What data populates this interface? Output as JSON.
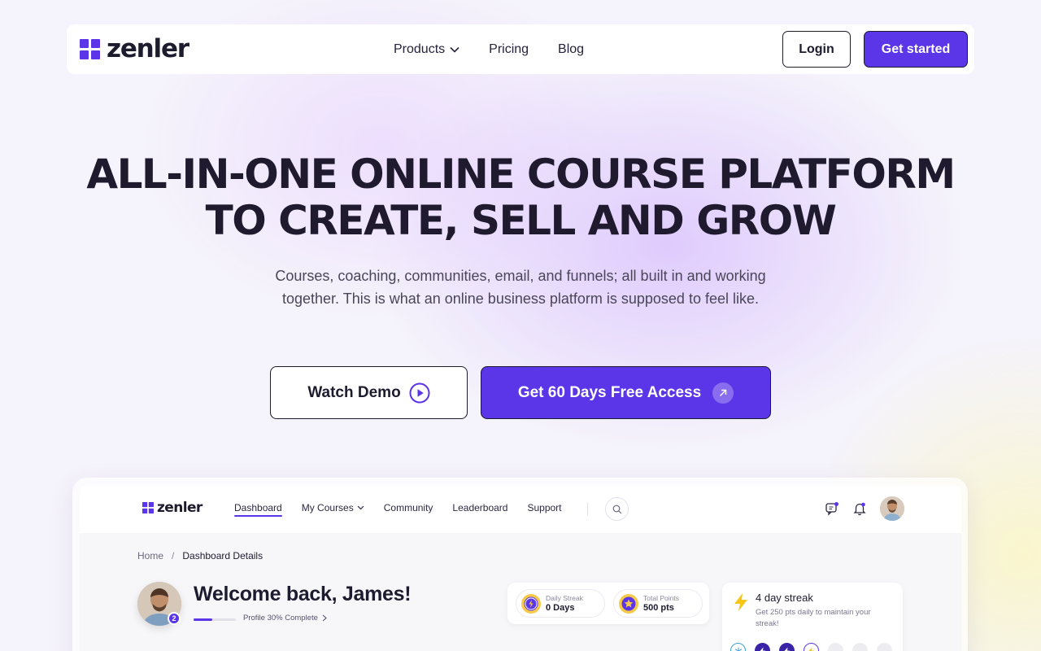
{
  "nav": {
    "brand": "zenler",
    "links": [
      {
        "label": "Products",
        "has_dropdown": true
      },
      {
        "label": "Pricing"
      },
      {
        "label": "Blog"
      }
    ],
    "login_label": "Login",
    "get_started_label": "Get started"
  },
  "hero": {
    "title_line1": "ALL-IN-ONE ONLINE COURSE PLATFORM",
    "title_line2": "TO CREATE, SELL AND GROW",
    "subtitle": "Courses, coaching, communities, email, and funnels; all built in and working together. This is what an online business platform is supposed to feel like.",
    "watch_demo_label": "Watch Demo",
    "free_access_label": "Get 60 Days Free Access"
  },
  "app": {
    "brand": "zenler",
    "links": [
      {
        "label": "Dashboard",
        "active": true
      },
      {
        "label": "My Courses",
        "has_dropdown": true
      },
      {
        "label": "Community"
      },
      {
        "label": "Leaderboard"
      },
      {
        "label": "Support"
      }
    ],
    "breadcrumb": {
      "home": "Home",
      "separator": "/",
      "current": "Dashboard Details"
    },
    "welcome": "Welcome back, James!",
    "level": "2",
    "profile_progress": 0.3,
    "profile_progress_text": "Profile 30% Complete",
    "stats": [
      {
        "label": "Daily Streak",
        "value": "0 Days"
      },
      {
        "label": "Total Points",
        "value": "500 pts"
      }
    ],
    "streak_card": {
      "title": "4 day streak",
      "description": "Get 250 pts daily to maintain your streak!"
    }
  },
  "colors": {
    "brand": "#5b35e8",
    "text_dark": "#1d1b2e",
    "streak_yellow": "#f5c518"
  }
}
